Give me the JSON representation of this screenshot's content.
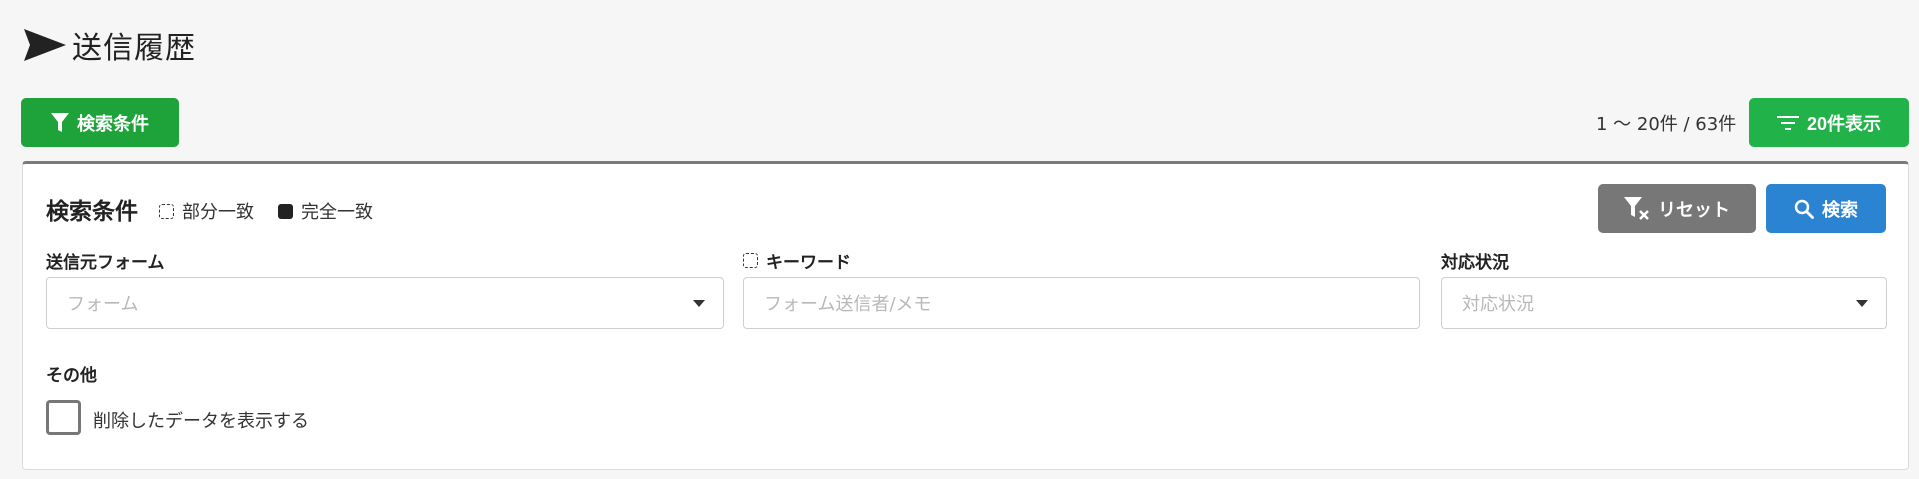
{
  "header": {
    "title": "送信履歴",
    "icon": "send-icon"
  },
  "toolbar": {
    "filter_button_label": "検索条件",
    "pager_text": "1 〜 20件 / 63件",
    "per_page_button_label": "20件表示"
  },
  "panel": {
    "title": "検索条件",
    "legend": {
      "partial": "部分一致",
      "exact": "完全一致"
    },
    "reset_label": "リセット",
    "search_label": "検索",
    "fields": {
      "form": {
        "label": "送信元フォーム",
        "placeholder": "フォーム"
      },
      "keyword": {
        "label": "キーワード",
        "placeholder": "フォーム送信者/メモ"
      },
      "status": {
        "label": "対応状況",
        "placeholder": "対応状況"
      }
    },
    "other": {
      "label": "その他",
      "checkbox_label": "削除したデータを表示する",
      "checked": false
    }
  },
  "colors": {
    "filter_button": "#1ea33a",
    "per_page_button": "#21b24a",
    "reset_button": "#777777",
    "search_button": "#2a84d2"
  }
}
